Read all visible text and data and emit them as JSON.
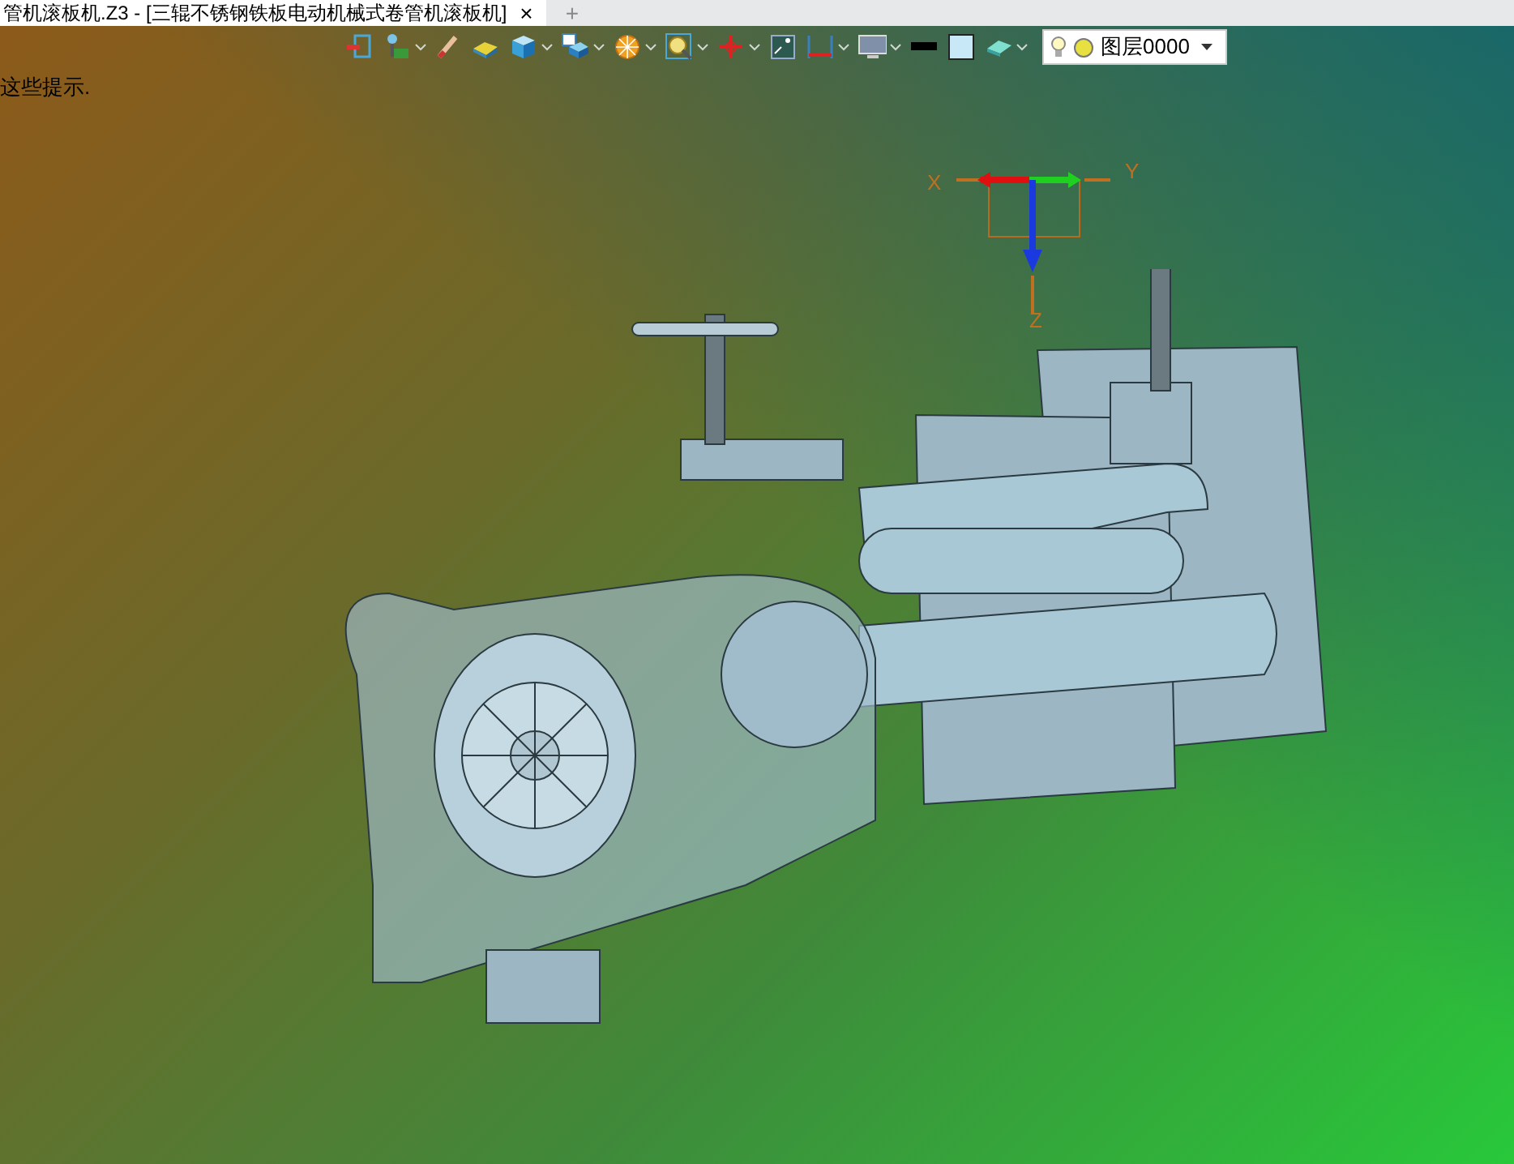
{
  "tab": {
    "title": "管机滚板机.Z3 - [三辊不锈钢铁板电动机械式卷管机滚板机]",
    "close": "×",
    "new_tab": "+"
  },
  "toolbar": {
    "tools": [
      {
        "dropdown": false
      },
      {
        "dropdown": true
      },
      {
        "dropdown": false
      },
      {
        "dropdown": false
      },
      {
        "dropdown": true
      },
      {
        "dropdown": true
      },
      {
        "dropdown": true
      },
      {
        "dropdown": true
      },
      {
        "dropdown": true
      },
      {
        "dropdown": false
      },
      {
        "dropdown": true
      },
      {
        "dropdown": true
      },
      {
        "dropdown": false
      },
      {
        "dropdown": false
      },
      {
        "dropdown": true
      }
    ],
    "layer": {
      "name": "图层0000"
    }
  },
  "hint": "这些提示.",
  "viewport": {
    "axis_labels": {
      "x": "X",
      "y": "Y",
      "z": "Z"
    }
  }
}
